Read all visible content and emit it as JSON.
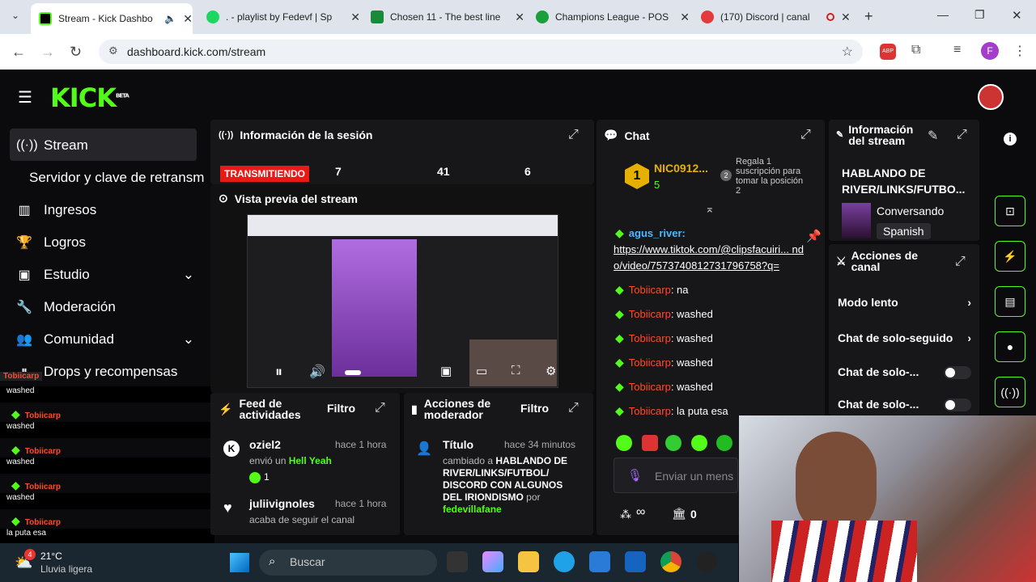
{
  "browser": {
    "tabs": [
      {
        "title": "Stream - Kick Dashbo",
        "color": "#53fc18"
      },
      {
        "title": ". - playlist by Fedevf | Sp",
        "color": "#1ed760"
      },
      {
        "title": "Chosen 11 - The best line",
        "color": "#1a8a3a"
      },
      {
        "title": "Champions League - POS",
        "color": "#1aa03a"
      },
      {
        "title": "(170) Discord | canal",
        "color": "#e33b3b"
      }
    ],
    "url": "dashboard.kick.com/stream",
    "profile_initial": "F"
  },
  "kick": {
    "logo": "KICK",
    "beta": "BETA",
    "sidebar": [
      {
        "label": "Stream",
        "icon": "broadcast-icon"
      },
      {
        "label": "Servidor y clave de retransm",
        "icon": ""
      },
      {
        "label": "Ingresos",
        "icon": "chart-icon"
      },
      {
        "label": "Logros",
        "icon": "trophy-icon"
      },
      {
        "label": "Estudio",
        "icon": "studio-icon"
      },
      {
        "label": "Moderación",
        "icon": "wrench-icon"
      },
      {
        "label": "Comunidad",
        "icon": "users-icon"
      },
      {
        "label": "Drops y recompensas",
        "icon": "gift-icon"
      }
    ],
    "session": {
      "title": "Información de la sesión",
      "live_badge": "TRANSMITIENDO",
      "stats": [
        "7",
        "41",
        "6"
      ]
    },
    "preview": {
      "title": "Vista previa del stream"
    },
    "activity": {
      "title": "Feed de actividades",
      "filter": "Filtro",
      "items": [
        {
          "user": "oziel2",
          "time": "hace 1 hora",
          "text": "envió un",
          "highlight": "Hell Yeah",
          "count": "1"
        },
        {
          "user": "juliivignoles",
          "time": "hace 1 hora",
          "text": "acaba de seguir el canal"
        }
      ]
    },
    "modactions": {
      "title": "Acciones de moderador",
      "filter": "Filtro",
      "item": {
        "label": "Título",
        "time": "hace 34 minutos",
        "prefix": "cambiado a",
        "value": "HABLANDO DE RIVER/LINKS/FUTBOL/ DISCORD CON ALGUNOS DEL IRIONDISMO",
        "by": "por",
        "author": "fedevillafane"
      }
    },
    "chat": {
      "title": "Chat",
      "top_user": "NIC0912...",
      "top_rank": "1",
      "top_count": "5",
      "promo": "Regala 1 suscripción para tomar la posición 2",
      "link_user": "agus_river:",
      "link_url": "https://www.tiktok.com/@clipsfacuiri... ndo/video/7573740812731796758?q=",
      "messages": [
        {
          "user": "Tobiicarp",
          "text": ": na"
        },
        {
          "user": "Tobiicarp",
          "text": ": washed"
        },
        {
          "user": "Tobiicarp",
          "text": ": washed"
        },
        {
          "user": "Tobiicarp",
          "text": ": washed"
        },
        {
          "user": "Tobiicarp",
          "text": ": washed"
        },
        {
          "user": "Tobiicarp",
          "text": ": la puta esa"
        }
      ],
      "input_placeholder": "Enviar un mens",
      "footer_count": "0",
      "infinity": "∞"
    },
    "stream_info": {
      "title": "Información del stream",
      "stream_title": "HABLANDO DE RIVER/LINKS/FUTBO...",
      "category": "Conversando",
      "language": "Spanish"
    },
    "channel_actions": {
      "title": "Acciones de canal",
      "items": [
        "Modo lento",
        "Chat de solo-seguido",
        "Chat de solo-...",
        "Chat de solo-..."
      ]
    },
    "overlay_chat": [
      {
        "user": "Tobiicarp",
        "text": "washed"
      },
      {
        "user": "Tobiicarp",
        "text": "washed"
      },
      {
        "user": "Tobiicarp",
        "text": "washed"
      },
      {
        "user": "Tobiicarp",
        "text": "washed"
      },
      {
        "user": "Tobiicarp",
        "text": "la puta esa"
      }
    ]
  },
  "taskbar": {
    "temp": "21°C",
    "weather": "Lluvia ligera",
    "badge": "4",
    "search": "Buscar"
  }
}
